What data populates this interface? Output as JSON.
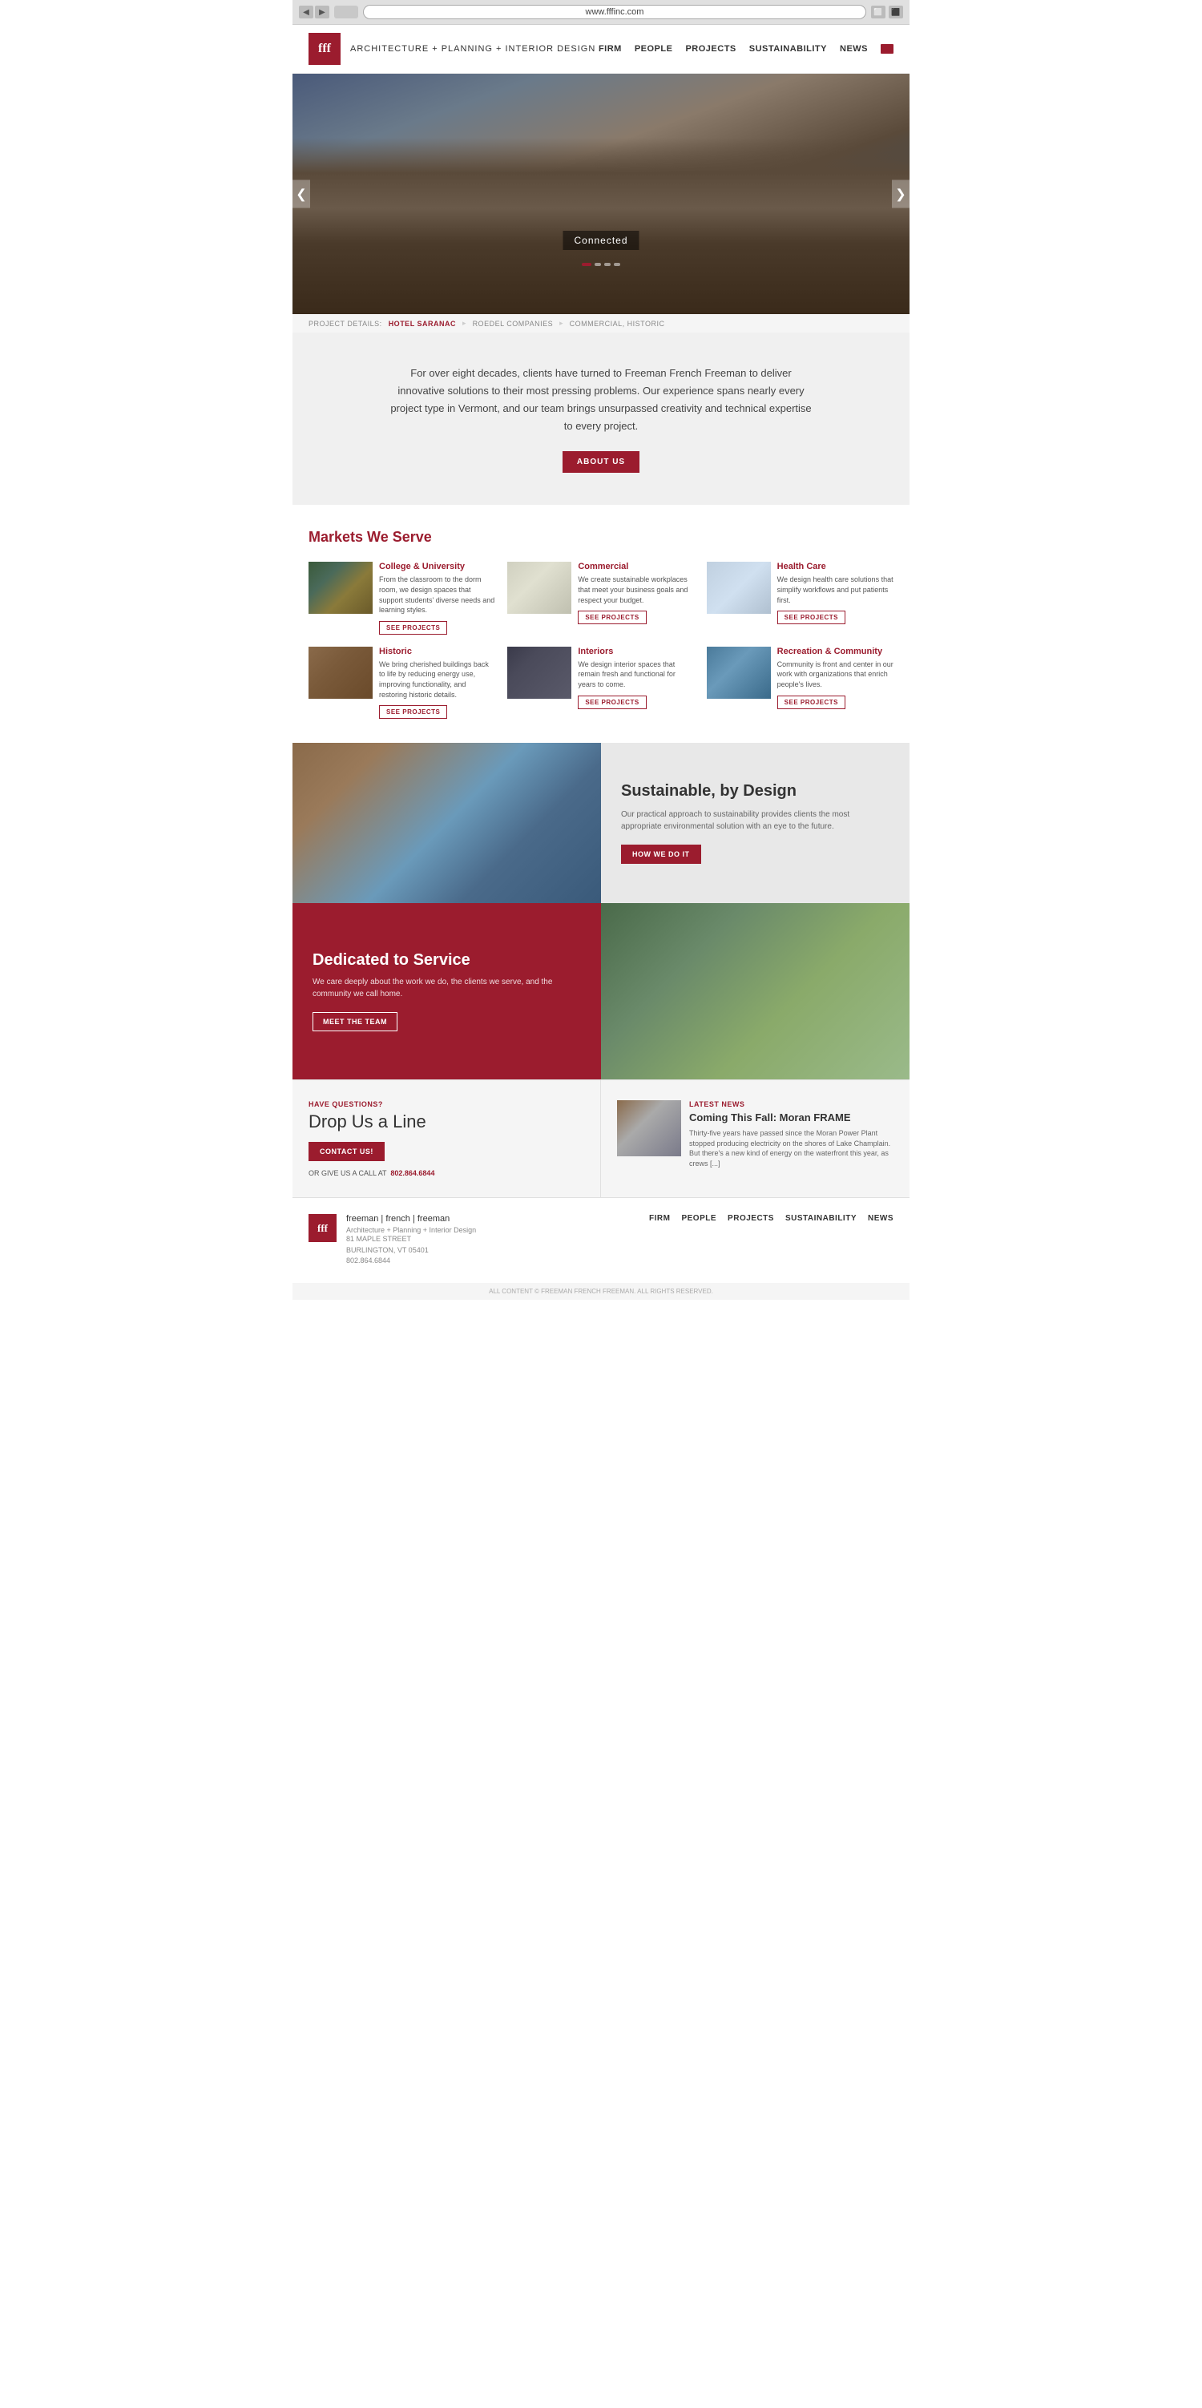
{
  "browser": {
    "url": "www.fffinc.com",
    "back_label": "◀",
    "forward_label": "▶"
  },
  "header": {
    "logo_text": "fff",
    "tagline": "ARCHITECTURE + PLANNING + INTERIOR DESIGN",
    "nav": {
      "firm": "FIRM",
      "people": "PEOPLE",
      "projects": "PROJECTS",
      "sustainability": "SUSTAINABILITY",
      "news": "NEWS"
    }
  },
  "hero": {
    "label": "Connected",
    "arrow_left": "❮",
    "arrow_right": "❯"
  },
  "project_bar": {
    "label": "PROJECT DETAILS:",
    "link": "HOTEL SARANAC",
    "sep1": "▸",
    "company": "ROEDEL COMPANIES",
    "sep2": "▸",
    "tags": "COMMERCIAL, HISTORIC"
  },
  "intro": {
    "text": "For over eight decades, clients have turned to Freeman French Freeman to deliver innovative solutions to their most pressing problems. Our experience spans nearly every project type in Vermont, and our team brings unsurpassed creativity and technical expertise to every project.",
    "about_btn": "ABOUT US"
  },
  "markets": {
    "title": "Markets We Serve",
    "items": [
      {
        "name": "College & University",
        "desc": "From the classroom to the dorm room, we design spaces that support students' diverse needs and learning styles.",
        "btn": "SEE PROJECTS",
        "img_class": "market-img-college"
      },
      {
        "name": "Commercial",
        "desc": "We create sustainable workplaces that meet your business goals and respect your budget.",
        "btn": "SEE PROJECTS",
        "img_class": "market-img-commercial"
      },
      {
        "name": "Health Care",
        "desc": "We design health care solutions that simplify workflows and put patients first.",
        "btn": "SEE PROJECTS",
        "img_class": "market-img-healthcare"
      },
      {
        "name": "Historic",
        "desc": "We bring cherished buildings back to life by reducing energy use, improving functionality, and restoring historic details.",
        "btn": "SEE PROJECTS",
        "img_class": "market-img-historic"
      },
      {
        "name": "Interiors",
        "desc": "We design interior spaces that remain fresh and functional for years to come.",
        "btn": "SEE PROJECTS",
        "img_class": "market-img-interiors"
      },
      {
        "name": "Recreation & Community",
        "desc": "Community is front and center in our work with organizations that enrich people's lives.",
        "btn": "SEE PROJECTS",
        "img_class": "market-img-recreation"
      }
    ]
  },
  "sustainability": {
    "title": "Sustainable, by Design",
    "desc": "Our practical approach to sustainability provides clients the most appropriate environmental solution with an eye to the future.",
    "btn": "HOW WE DO IT"
  },
  "service": {
    "title": "Dedicated to Service",
    "desc": "We care deeply about the work we do, the clients we serve, and the community we call home.",
    "btn": "MEET THE TEAM"
  },
  "contact": {
    "pre": "HAVE QUESTIONS?",
    "title": "Drop Us a Line",
    "btn": "CONTACT US!",
    "phone_pre": "OR GIVE US A CALL AT",
    "phone": "802.864.6844"
  },
  "news": {
    "pre": "LATEST NEWS",
    "title": "Coming This Fall: Moran FRAME",
    "text": "Thirty-five years have passed since the Moran Power Plant stopped producing electricity on the shores of Lake Champlain. But there's a new kind of energy on the waterfront this year, as crews [...]"
  },
  "footer": {
    "logo_text": "fff",
    "firm_name": "freeman | french | freeman",
    "tagline": "Architecture + Planning + Interior Design",
    "address_line1": "81 MAPLE STREET",
    "address_line2": "BURLINGTON, VT 05401",
    "phone": "802.864.6844",
    "nav": {
      "firm": "FIRM",
      "people": "PEOPLE",
      "projects": "PROJECTS",
      "sustainability": "SUSTAINABILITY",
      "news": "NEWS"
    }
  },
  "copyright": "ALL CONTENT © FREEMAN FRENCH FREEMAN. ALL RIGHTS RESERVED."
}
